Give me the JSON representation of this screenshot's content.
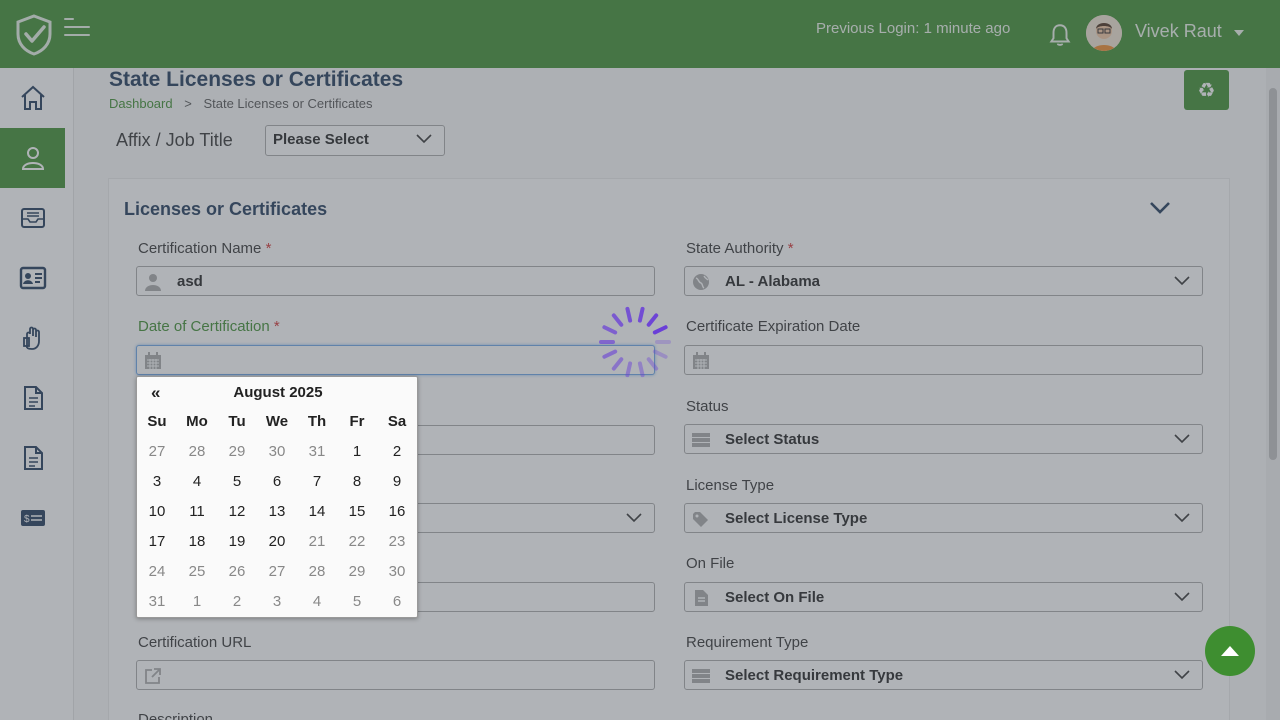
{
  "header": {
    "previous_login": "Previous Login: 1 minute ago",
    "user_name": "Vivek Raut"
  },
  "page": {
    "title": "State Licenses or Certificates",
    "breadcrumb_home": "Dashboard",
    "breadcrumb_separator": ">",
    "breadcrumb_current": "State Licenses or Certificates"
  },
  "affix": {
    "label": "Affix / Job Title",
    "value": "Please Select"
  },
  "card": {
    "title": "Licenses or Certificates"
  },
  "form": {
    "certification_name": {
      "label": "Certification Name",
      "required": "*",
      "value": "asd"
    },
    "state_authority": {
      "label": "State Authority",
      "required": "*",
      "value": "AL - Alabama"
    },
    "date_of_certification": {
      "label": "Date of Certification",
      "required": "*",
      "value": ""
    },
    "expiration_date": {
      "label": "Certificate Expiration Date",
      "value": ""
    },
    "status": {
      "label": "Status",
      "value": "Select Status"
    },
    "license_type": {
      "label": "License Type",
      "value": "Select License Type"
    },
    "on_file": {
      "label": "On File",
      "value": "Select On File"
    },
    "certification_url": {
      "label": "Certification URL",
      "value": ""
    },
    "requirement_type": {
      "label": "Requirement Type",
      "value": "Select Requirement Type"
    },
    "description": {
      "label": "Description"
    }
  },
  "calendar": {
    "prev": "«",
    "month": "August 2025",
    "weekdays": [
      "Su",
      "Mo",
      "Tu",
      "We",
      "Th",
      "Fr",
      "Sa"
    ],
    "weeks": [
      [
        {
          "d": "27",
          "m": true
        },
        {
          "d": "28",
          "m": true
        },
        {
          "d": "29",
          "m": true
        },
        {
          "d": "30",
          "m": true
        },
        {
          "d": "31",
          "m": true
        },
        {
          "d": "1",
          "m": false
        },
        {
          "d": "2",
          "m": false
        }
      ],
      [
        {
          "d": "3",
          "m": false
        },
        {
          "d": "4",
          "m": false
        },
        {
          "d": "5",
          "m": false
        },
        {
          "d": "6",
          "m": false
        },
        {
          "d": "7",
          "m": false
        },
        {
          "d": "8",
          "m": false
        },
        {
          "d": "9",
          "m": false
        }
      ],
      [
        {
          "d": "10",
          "m": false
        },
        {
          "d": "11",
          "m": false
        },
        {
          "d": "12",
          "m": false
        },
        {
          "d": "13",
          "m": false
        },
        {
          "d": "14",
          "m": false
        },
        {
          "d": "15",
          "m": false
        },
        {
          "d": "16",
          "m": false
        }
      ],
      [
        {
          "d": "17",
          "m": false
        },
        {
          "d": "18",
          "m": false
        },
        {
          "d": "19",
          "m": false
        },
        {
          "d": "20",
          "m": false
        },
        {
          "d": "21",
          "m": true
        },
        {
          "d": "22",
          "m": true
        },
        {
          "d": "23",
          "m": true
        }
      ],
      [
        {
          "d": "24",
          "m": true
        },
        {
          "d": "25",
          "m": true
        },
        {
          "d": "26",
          "m": true
        },
        {
          "d": "27",
          "m": true
        },
        {
          "d": "28",
          "m": true
        },
        {
          "d": "29",
          "m": true
        },
        {
          "d": "30",
          "m": true
        }
      ],
      [
        {
          "d": "31",
          "m": true
        },
        {
          "d": "1",
          "m": true
        },
        {
          "d": "2",
          "m": true
        },
        {
          "d": "3",
          "m": true
        },
        {
          "d": "4",
          "m": true
        },
        {
          "d": "5",
          "m": true
        },
        {
          "d": "6",
          "m": true
        }
      ]
    ]
  },
  "sidebar": {
    "items": [
      {
        "icon": "home-icon"
      },
      {
        "icon": "user-icon",
        "active": true
      },
      {
        "icon": "inbox-icon"
      },
      {
        "icon": "id-card-icon"
      },
      {
        "icon": "hand-icon"
      },
      {
        "icon": "document-icon"
      },
      {
        "icon": "document-icon"
      },
      {
        "icon": "billing-icon"
      }
    ]
  },
  "colors": {
    "brand_green": "#3e8e30",
    "title_navy": "#1f3a5a",
    "required_red": "#d32f2f",
    "spinner_purple": "#6a3fd8"
  }
}
